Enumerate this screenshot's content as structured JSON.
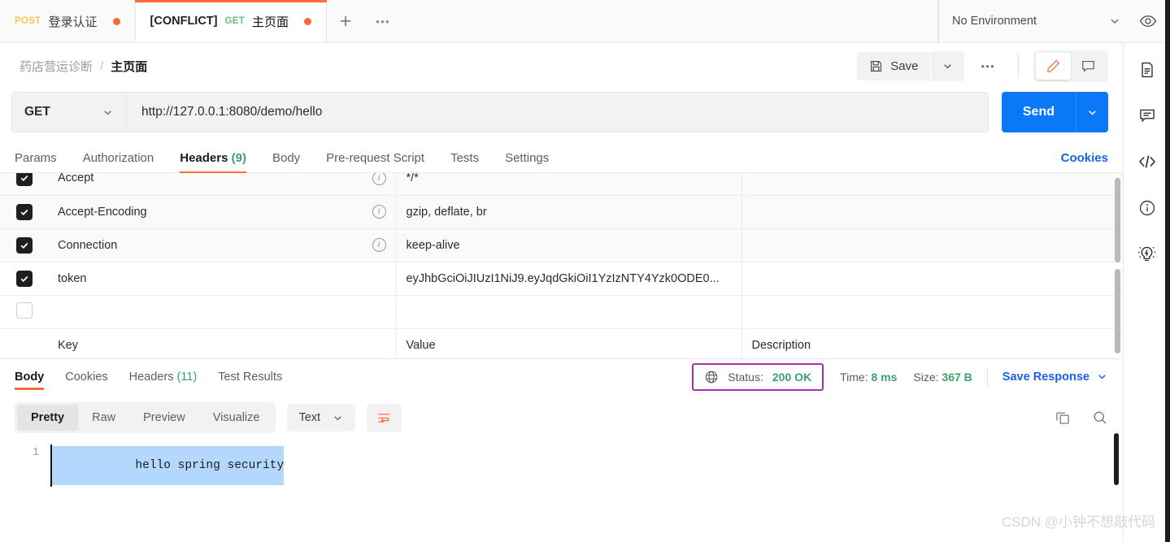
{
  "tabstrip": {
    "tabs": [
      {
        "method": "POST",
        "prefix": "",
        "name": "登录认证",
        "active": false,
        "unsaved": true
      },
      {
        "method": "GET",
        "prefix": "[CONFLICT]",
        "name": "主页面",
        "active": true,
        "unsaved": true
      }
    ],
    "add_label": "+",
    "more_label": "•••"
  },
  "environment": {
    "selected": "No Environment",
    "chevron_icon": "chevron-down-icon",
    "eye_icon": "eye-icon"
  },
  "breadcrumb": {
    "collection": "药店营运诊断",
    "separator": "/",
    "current": "主页面"
  },
  "toolbar": {
    "save_label": "Save",
    "save_icon": "floppy-disk-icon",
    "save_caret_icon": "chevron-down-icon",
    "more_label": "•••",
    "edit_icon": "pencil-icon",
    "comment_icon": "comment-icon",
    "edit_active": true
  },
  "request": {
    "method": "GET",
    "method_caret_icon": "chevron-down-icon",
    "url": "http://127.0.0.1:8080/demo/hello",
    "send_label": "Send",
    "send_caret_icon": "chevron-down-icon",
    "tabs": [
      {
        "label": "Params",
        "count": "",
        "active": false
      },
      {
        "label": "Authorization",
        "count": "",
        "active": false
      },
      {
        "label": "Headers",
        "count": "(9)",
        "active": true
      },
      {
        "label": "Body",
        "count": "",
        "active": false
      },
      {
        "label": "Pre-request Script",
        "count": "",
        "active": false
      },
      {
        "label": "Tests",
        "count": "",
        "active": false
      },
      {
        "label": "Settings",
        "count": "",
        "active": false
      }
    ],
    "cookies_link": "Cookies"
  },
  "headers_table": {
    "columns": [
      "Key",
      "Value",
      "Description"
    ],
    "placeholders": {
      "key": "Key",
      "value": "Value",
      "description": "Description"
    },
    "rows": [
      {
        "checked": true,
        "key": "Accept",
        "has_info": true,
        "value": "*/*",
        "description": "",
        "dim": true,
        "clipped": true
      },
      {
        "checked": true,
        "key": "Accept-Encoding",
        "has_info": true,
        "value": "gzip, deflate, br",
        "description": "",
        "dim": true
      },
      {
        "checked": true,
        "key": "Connection",
        "has_info": true,
        "value": "keep-alive",
        "description": "",
        "dim": true
      },
      {
        "checked": true,
        "key": "token",
        "has_info": false,
        "value": "eyJhbGciOiJIUzI1NiJ9.eyJqdGkiOiI1YzIzNTY4Yzk0ODE0...",
        "description": "",
        "dim": false
      },
      {
        "checked": false,
        "key": "",
        "has_info": false,
        "value": "",
        "description": "",
        "dim": false
      }
    ]
  },
  "response": {
    "tabs": [
      {
        "label": "Body",
        "count": "",
        "active": true
      },
      {
        "label": "Cookies",
        "count": "",
        "active": false
      },
      {
        "label": "Headers",
        "count": "(11)",
        "active": false
      },
      {
        "label": "Test Results",
        "count": "",
        "active": false
      }
    ],
    "status_label": "Status:",
    "status_value": "200 OK",
    "time_label": "Time:",
    "time_value": "8 ms",
    "size_label": "Size:",
    "size_value": "367 B",
    "globe_icon": "globe-icon",
    "save_response_label": "Save Response",
    "save_response_caret_icon": "chevron-down-icon",
    "highlight_color": "#a331ab",
    "format_tabs": [
      {
        "label": "Pretty",
        "active": true
      },
      {
        "label": "Raw",
        "active": false
      },
      {
        "label": "Preview",
        "active": false
      },
      {
        "label": "Visualize",
        "active": false
      }
    ],
    "format_type": "Text",
    "format_type_caret_icon": "chevron-down-icon",
    "wrap_icon": "word-wrap-icon",
    "copy_icon": "copy-icon",
    "search_icon": "search-icon",
    "body_line_number": "1",
    "body_text": "hello spring security"
  },
  "rail": {
    "icons": [
      "documentation-icon",
      "comments-icon",
      "code-snippet-icon",
      "info-icon",
      "lightbulb-icon"
    ]
  },
  "watermark": "CSDN @小钟不想敲代码",
  "colors": {
    "accent": "#ff6c37",
    "send": "#0b79f7",
    "success": "#3ea06a",
    "link": "#1b62e8",
    "highlight": "#a331ab",
    "selection": "#b4d7fd"
  }
}
